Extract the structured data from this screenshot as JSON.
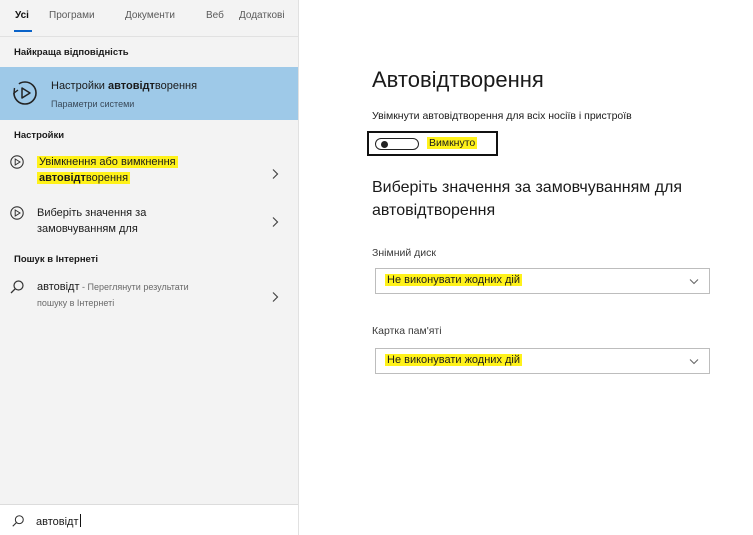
{
  "search_panel": {
    "tabs": [
      {
        "label": "Усі",
        "active": true
      },
      {
        "label": "Програми"
      },
      {
        "label": "Документи"
      },
      {
        "label": "Веб"
      },
      {
        "label": "Додаткові"
      }
    ],
    "best_match": {
      "heading": "Найкраща відповідність",
      "title_before": "Настройки ",
      "title_bold": "автовідт",
      "title_after": "ворення",
      "subtitle": "Параметри системи",
      "icon": "autoplay-icon"
    },
    "settings": {
      "heading": "Настройки",
      "items": [
        {
          "line1": "Увімкнення або вимкнення",
          "line2_bold": "автовідт",
          "line2_rest": "ворення",
          "highlighted": true,
          "icon": "autoplay-icon"
        },
        {
          "line1": "Виберіть значення за",
          "line2": "замовчуванням для",
          "highlighted": false,
          "icon": "autoplay-icon"
        }
      ]
    },
    "web": {
      "heading": "Пошук в Інтернеті",
      "query": "автовідт",
      "hint": " - Переглянути результати",
      "hint_line2": "пошуку в Інтернеті",
      "icon": "search-icon"
    },
    "search_box": {
      "value": "автовідт",
      "icon": "search-icon"
    }
  },
  "settings_page": {
    "title": "Автовідтворення",
    "toggle_label": "Увімкнути автовідтворення для всіх носіїв і пристроїв",
    "toggle_state": "Вимкнуто",
    "toggle_on": false,
    "defaults_heading": "Виберіть значення за замовчуванням для автовідтворення",
    "removable_drive": {
      "label": "Знімний диск",
      "value": "Не виконувати жодних дій"
    },
    "memory_card": {
      "label": "Картка пам'яті",
      "value": "Не виконувати жодних дій"
    }
  },
  "colors": {
    "selection": "#9ec9e8",
    "highlight": "#fff21a",
    "panel_bg": "#f3f3f3",
    "accent": "#0a63c9"
  }
}
